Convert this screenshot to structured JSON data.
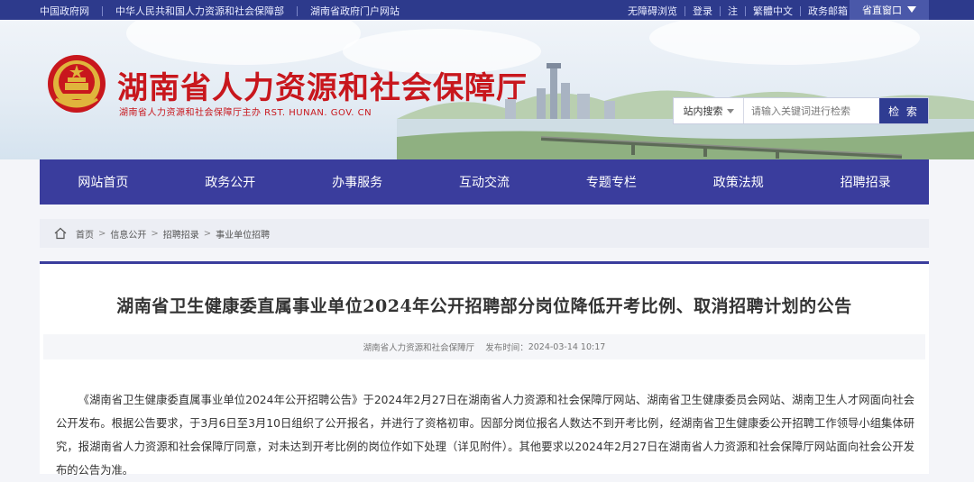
{
  "topbar": {
    "links": [
      "中国政府网",
      "中华人民共和国人力资源和社会保障部",
      "湖南省政府门户网站"
    ],
    "right_links": [
      "无障碍浏览",
      "登录",
      "注",
      "繁體中文",
      "政务邮箱"
    ],
    "window_label": "省直窗口",
    "window_icon": "caret-down-icon"
  },
  "header": {
    "title": "湖南省人力资源和社会保障厅",
    "subtitle": "湖南省人力资源和社会保障厅主办  RST. HUNAN. GOV. CN",
    "emblem_icon": "national-emblem-icon"
  },
  "search": {
    "scope": "站内搜索",
    "placeholder": "请输入关键词进行检索",
    "value": "",
    "button_label": "检 索"
  },
  "nav": {
    "items": [
      "网站首页",
      "政务公开",
      "办事服务",
      "互动交流",
      "专题专栏",
      "政策法规",
      "招聘招录"
    ]
  },
  "breadcrumb": {
    "items": [
      "首页",
      "信息公开",
      "招聘招录",
      "事业单位招聘"
    ],
    "separator": ">",
    "home_icon": "home-icon"
  },
  "article": {
    "title": "湖南省卫生健康委直属事业单位2024年公开招聘部分岗位降低开考比例、取消招聘计划的公告",
    "source": "湖南省人力资源和社会保障厅",
    "time_label": "发布时间：",
    "time": "2024-03-14 10:17",
    "body": "《湖南省卫生健康委直属事业单位2024年公开招聘公告》于2024年2月27日在湖南省人力资源和社会保障厅网站、湖南省卫生健康委员会网站、湖南卫生人才网面向社会公开发布。根据公告要求，于3月6日至3月10日组织了公开报名，并进行了资格初审。因部分岗位报名人数达不到开考比例，经湖南省卫生健康委公开招聘工作领导小组集体研究，报湖南省人力资源和社会保障厅同意，对未达到开考比例的岗位作如下处理（详见附件）。其他要求以2024年2月27日在湖南省人力资源和社会保障厅网站面向社会公开发布的公告为准。"
  },
  "colors": {
    "topbar": "#2d3a8c",
    "nav": "#3a3d9d",
    "title_red": "#c8171d",
    "search_button": "#2f3c92"
  }
}
